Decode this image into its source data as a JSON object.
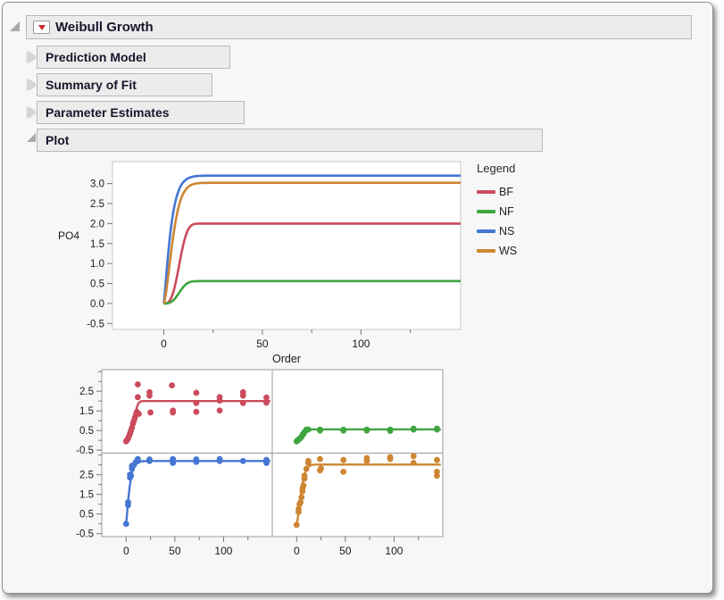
{
  "outline": {
    "title": "Weibull Growth",
    "sections": [
      {
        "label": "Prediction Model",
        "state": "collapsed"
      },
      {
        "label": "Summary of Fit",
        "state": "collapsed"
      },
      {
        "label": "Parameter Estimates",
        "state": "collapsed"
      },
      {
        "label": "Plot",
        "state": "expanded"
      }
    ]
  },
  "legend": {
    "title": "Legend",
    "items": [
      {
        "label": "BF",
        "color": "#cb4b5c"
      },
      {
        "label": "NF",
        "color": "#3fa53f"
      },
      {
        "label": "NS",
        "color": "#4576d2"
      },
      {
        "label": "WS",
        "color": "#cd8633"
      }
    ]
  },
  "colors": {
    "window_bg": "#f7f7f7",
    "bar_fill": "#ececec",
    "bar_border": "#b9b9b9",
    "header_text": "#17172c",
    "red_triangle": "#cc2a2a",
    "plot_border": "#c9c9c9",
    "tick": "#777777",
    "tick_text": "#1a1a1a"
  },
  "chart_data": [
    {
      "type": "line",
      "title": "",
      "xlabel": "Order",
      "ylabel": "PO4",
      "xlim": [
        -26,
        150.5
      ],
      "ylim": [
        -0.65,
        3.55
      ],
      "x_major_ticks": [
        0,
        50,
        100
      ],
      "x_minor_ticks": [
        25,
        75,
        125
      ],
      "y_ticks": [
        -0.5,
        0.0,
        0.5,
        1.0,
        1.5,
        2.0,
        2.5,
        3.0
      ],
      "y_tick_labels": [
        "-0.5",
        "0.0",
        "0.5",
        "1.0",
        "1.5",
        "2.0",
        "2.5",
        "3.0"
      ],
      "grid": false,
      "legend_position": "right",
      "series": [
        {
          "name": "BF",
          "color": "#cb4b5c",
          "asymptote": 2.0,
          "weibull": {
            "A": 2.0,
            "b": 9.0,
            "c": 3.0
          }
        },
        {
          "name": "NF",
          "color": "#3fa53f",
          "asymptote": 0.56,
          "weibull": {
            "A": 0.56,
            "b": 9.0,
            "c": 3.0
          }
        },
        {
          "name": "NS",
          "color": "#4576d2",
          "asymptote": 3.2,
          "weibull": {
            "A": 3.2,
            "b": 4.0,
            "c": 1.2
          }
        },
        {
          "name": "WS",
          "color": "#cd8633",
          "asymptote": 3.01,
          "weibull": {
            "A": 3.02,
            "b": 5.5,
            "c": 1.5
          }
        }
      ]
    },
    {
      "type": "scatter",
      "title": "",
      "xlim": [
        -25,
        150
      ],
      "ylim": [
        -0.65,
        3.6
      ],
      "x_major_ticks": [
        0,
        50,
        100
      ],
      "x_minor_ticks": [
        25,
        75,
        125
      ],
      "y_major_ticks": [
        -0.5,
        0.5,
        1.5,
        2.5
      ],
      "y_minor_ticks": [
        0.0,
        1.0,
        2.0,
        3.0,
        3.5
      ],
      "y_major_tick_labels": [
        "-0.5",
        "0.5",
        "1.5",
        "2.5"
      ],
      "grid": false,
      "panels": [
        {
          "name": "BF",
          "color": "#cb4b5c",
          "fit": {
            "A": 2.0,
            "b": 9.0,
            "c": 3.0
          },
          "points": [
            [
              0,
              -0.05
            ],
            [
              1,
              0.02
            ],
            [
              2,
              0.1
            ],
            [
              3,
              0.22
            ],
            [
              4,
              0.35
            ],
            [
              5,
              0.5
            ],
            [
              6,
              0.65
            ],
            [
              7,
              0.85
            ],
            [
              8,
              1.0
            ],
            [
              9,
              1.15
            ],
            [
              10,
              1.32
            ],
            [
              11,
              1.45
            ],
            [
              12,
              2.2
            ],
            [
              12,
              2.85
            ],
            [
              13,
              1.35
            ],
            [
              24,
              2.45
            ],
            [
              24,
              2.28
            ],
            [
              25,
              1.42
            ],
            [
              47,
              2.8
            ],
            [
              48,
              1.52
            ],
            [
              48,
              1.42
            ],
            [
              72,
              2.42
            ],
            [
              72,
              1.9
            ],
            [
              72,
              1.45
            ],
            [
              96,
              2.2
            ],
            [
              96,
              2.02
            ],
            [
              96,
              1.52
            ],
            [
              120,
              2.45
            ],
            [
              120,
              2.28
            ],
            [
              120,
              1.9
            ],
            [
              144,
              2.18
            ],
            [
              144,
              1.92
            ]
          ]
        },
        {
          "name": "NF",
          "color": "#3fa53f",
          "fit": {
            "A": 0.56,
            "b": 9.0,
            "c": 3.0
          },
          "points": [
            [
              0,
              -0.05
            ],
            [
              1,
              0.0
            ],
            [
              2,
              0.04
            ],
            [
              3,
              0.08
            ],
            [
              4,
              0.13
            ],
            [
              5,
              0.18
            ],
            [
              6,
              0.28
            ],
            [
              7,
              0.33
            ],
            [
              8,
              0.42
            ],
            [
              10,
              0.55
            ],
            [
              12,
              0.55
            ],
            [
              24,
              0.55
            ],
            [
              24,
              0.5
            ],
            [
              48,
              0.55
            ],
            [
              48,
              0.5
            ],
            [
              72,
              0.55
            ],
            [
              72,
              0.5
            ],
            [
              96,
              0.55
            ],
            [
              96,
              0.48
            ],
            [
              120,
              0.6
            ],
            [
              120,
              0.55
            ],
            [
              144,
              0.6
            ],
            [
              144,
              0.55
            ]
          ]
        },
        {
          "name": "NS",
          "color": "#4576d2",
          "fit": {
            "A": 3.2,
            "b": 4.0,
            "c": 1.2
          },
          "points": [
            [
              0,
              0.0
            ],
            [
              2,
              0.95
            ],
            [
              2,
              1.1
            ],
            [
              4,
              2.35
            ],
            [
              4,
              2.5
            ],
            [
              5,
              2.45
            ],
            [
              6,
              2.8
            ],
            [
              6,
              2.95
            ],
            [
              8,
              3.0
            ],
            [
              10,
              3.15
            ],
            [
              12,
              3.3
            ],
            [
              12,
              3.2
            ],
            [
              24,
              3.2
            ],
            [
              24,
              3.28
            ],
            [
              48,
              3.2
            ],
            [
              48,
              3.1
            ],
            [
              48,
              3.3
            ],
            [
              72,
              3.28
            ],
            [
              72,
              3.15
            ],
            [
              96,
              3.3
            ],
            [
              96,
              3.2
            ],
            [
              120,
              3.2
            ],
            [
              144,
              3.25
            ],
            [
              144,
              3.1
            ]
          ]
        },
        {
          "name": "WS",
          "color": "#cd8633",
          "fit": {
            "A": 3.02,
            "b": 5.5,
            "c": 1.5
          },
          "points": [
            [
              0,
              -0.05
            ],
            [
              2,
              0.6
            ],
            [
              2,
              0.75
            ],
            [
              3,
              1.0
            ],
            [
              4,
              1.1
            ],
            [
              5,
              1.35
            ],
            [
              6,
              1.65
            ],
            [
              6,
              1.8
            ],
            [
              7,
              1.95
            ],
            [
              8,
              2.3
            ],
            [
              8,
              2.45
            ],
            [
              10,
              2.8
            ],
            [
              12,
              3.1
            ],
            [
              12,
              3.2
            ],
            [
              24,
              3.3
            ],
            [
              24,
              2.72
            ],
            [
              25,
              2.82
            ],
            [
              48,
              3.25
            ],
            [
              48,
              2.65
            ],
            [
              72,
              3.35
            ],
            [
              72,
              3.2
            ],
            [
              96,
              3.4
            ],
            [
              96,
              3.3
            ],
            [
              120,
              3.45
            ],
            [
              120,
              3.1
            ],
            [
              144,
              3.25
            ],
            [
              144,
              2.65
            ],
            [
              144,
              2.45
            ]
          ]
        }
      ]
    }
  ]
}
